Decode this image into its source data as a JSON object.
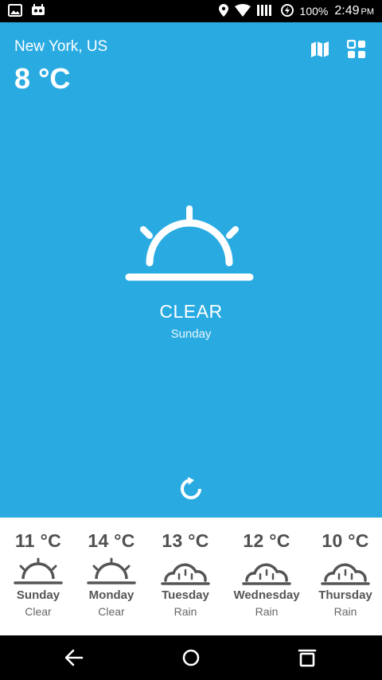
{
  "status_bar": {
    "battery": "100%",
    "time": "2:49",
    "ampm": "PM"
  },
  "header": {
    "location": "New York, US",
    "temperature": "8 °C"
  },
  "current": {
    "condition": "CLEAR",
    "day": "Sunday",
    "icon": "sunrise-icon"
  },
  "forecast": [
    {
      "temp": "11 °C",
      "day": "Sunday",
      "condition": "Clear",
      "icon": "sunrise-icon"
    },
    {
      "temp": "14 °C",
      "day": "Monday",
      "condition": "Clear",
      "icon": "sunrise-icon"
    },
    {
      "temp": "13 °C",
      "day": "Tuesday",
      "condition": "Rain",
      "icon": "rain-cloud-icon"
    },
    {
      "temp": "12 °C",
      "day": "Wednesday",
      "condition": "Rain",
      "icon": "rain-cloud-icon"
    },
    {
      "temp": "10 °C",
      "day": "Thursday",
      "condition": "Rain",
      "icon": "rain-cloud-icon"
    }
  ],
  "colors": {
    "background": "#29ABE2",
    "forecast_bg": "#FFFFFF",
    "forecast_text": "#555555"
  }
}
